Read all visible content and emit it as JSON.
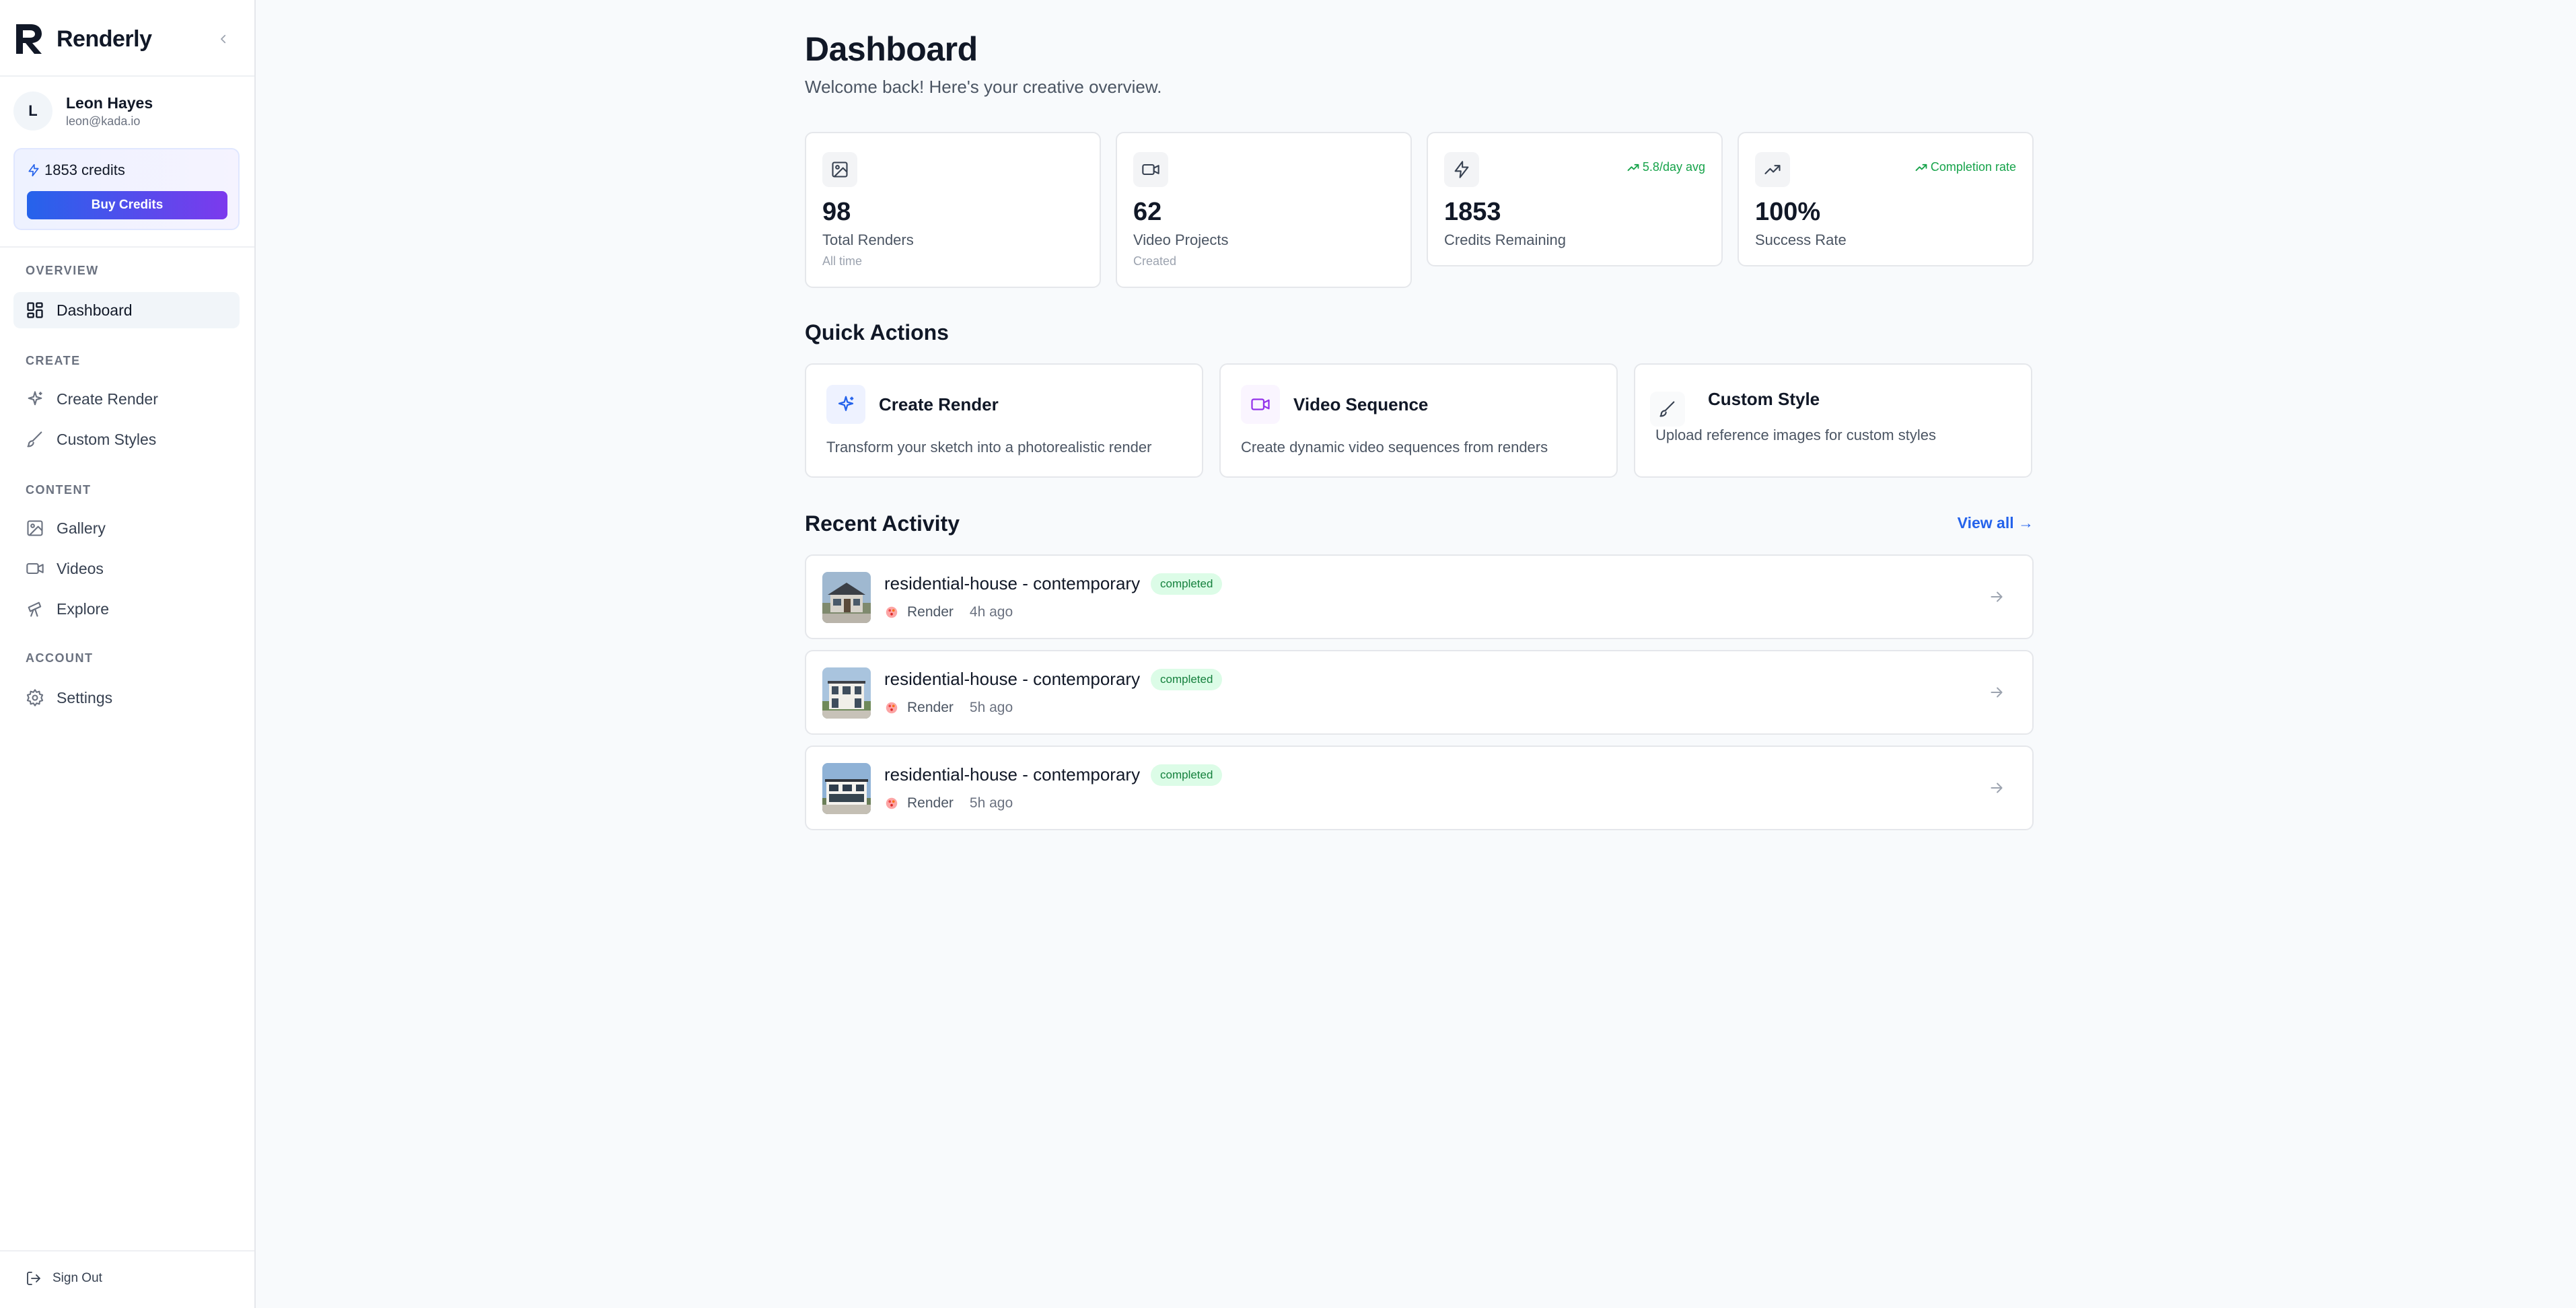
{
  "app": {
    "name": "Renderly",
    "collapse_icon": "chevron-left-icon"
  },
  "user": {
    "initial": "L",
    "name": "Leon Hayes",
    "email": "leon@kada.io"
  },
  "credits": {
    "label": "1853 credits",
    "buy_label": "Buy Credits"
  },
  "nav": {
    "sections": {
      "overview": "OVERVIEW",
      "create": "CREATE",
      "content": "CONTENT",
      "account": "ACCOUNT"
    },
    "items": {
      "dashboard": "Dashboard",
      "create_render": "Create Render",
      "custom_styles": "Custom Styles",
      "gallery": "Gallery",
      "videos": "Videos",
      "explore": "Explore",
      "settings": "Settings"
    },
    "sign_out": "Sign Out"
  },
  "page": {
    "title": "Dashboard",
    "subtitle": "Welcome back! Here's your creative overview."
  },
  "stats": [
    {
      "value": "98",
      "label": "Total Renders",
      "note": "All time",
      "trend": "",
      "icon": "image-icon"
    },
    {
      "value": "62",
      "label": "Video Projects",
      "note": "Created",
      "trend": "",
      "icon": "video-icon"
    },
    {
      "value": "1853",
      "label": "Credits Remaining",
      "note": "",
      "trend": "5.8/day avg",
      "icon": "zap-icon"
    },
    {
      "value": "100%",
      "label": "Success Rate",
      "note": "",
      "trend": "Completion rate",
      "icon": "trending-up-icon"
    }
  ],
  "quick_actions": {
    "title": "Quick Actions",
    "items": [
      {
        "title": "Create Render",
        "desc": "Transform your sketch into a photorealistic render",
        "icon": "sparkles-icon"
      },
      {
        "title": "Video Sequence",
        "desc": "Create dynamic video sequences from renders",
        "icon": "video-icon"
      },
      {
        "title": "Custom Style",
        "desc": "Upload reference images for custom styles",
        "icon": "brush-icon"
      }
    ]
  },
  "recent_activity": {
    "title": "Recent Activity",
    "view_all": "View all →",
    "items": [
      {
        "title": "residential-house - contemporary",
        "status": "completed",
        "type": "Render",
        "time": "4h ago"
      },
      {
        "title": "residential-house - contemporary",
        "status": "completed",
        "type": "Render",
        "time": "5h ago"
      },
      {
        "title": "residential-house - contemporary",
        "status": "completed",
        "type": "Render",
        "time": "5h ago"
      }
    ]
  },
  "colors": {
    "accent_blue": "#2563eb",
    "accent_purple": "#7c3aed",
    "success_green": "#16a34a",
    "badge_bg": "#dcfce7"
  }
}
